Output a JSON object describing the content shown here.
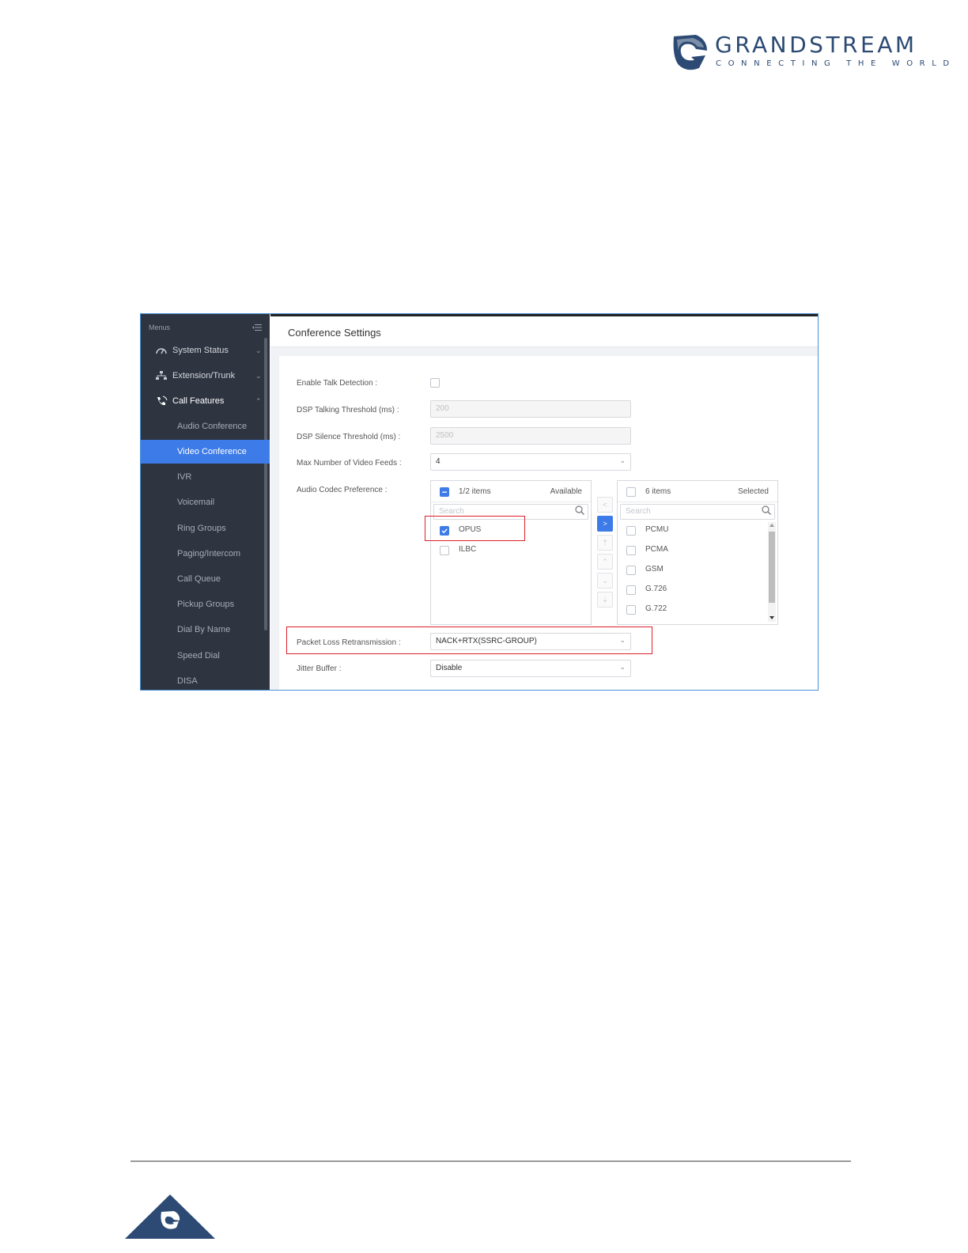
{
  "header": {
    "brand": "GRANDSTREAM",
    "tagline": "CONNECTING THE WORLD",
    "brand_color": "#2c4a73"
  },
  "sidebar": {
    "menus_label": "Menus",
    "items": [
      {
        "label": "System Status",
        "icon": "speedometer-icon",
        "chevron": "⌄"
      },
      {
        "label": "Extension/Trunk",
        "icon": "network-icon",
        "chevron": "⌄"
      },
      {
        "label": "Call Features",
        "icon": "phone-icon",
        "chevron": "⌃"
      }
    ],
    "sub_items": [
      "Audio Conference",
      "Video Conference",
      "IVR",
      "Voicemail",
      "Ring Groups",
      "Paging/Intercom",
      "Call Queue",
      "Pickup Groups",
      "Dial By Name",
      "Speed Dial",
      "DISA"
    ],
    "active_sub_item": "Video Conference",
    "active_color": "#3d7be8"
  },
  "content": {
    "title": "Conference Settings",
    "fields": {
      "enable_talk_detection": {
        "label": "Enable Talk Detection :"
      },
      "dsp_talking": {
        "label": "DSP Talking Threshold (ms) :",
        "value": "200"
      },
      "dsp_silence": {
        "label": "DSP Silence Threshold (ms) :",
        "value": "2500"
      },
      "max_video_feeds": {
        "label": "Max Number of Video Feeds :",
        "value": "4"
      },
      "audio_codec": {
        "label": "Audio Codec Preference :"
      },
      "packet_loss": {
        "label": "Packet Loss Retransmission :",
        "value": "NACK+RTX(SSRC-GROUP)"
      },
      "jitter_buffer": {
        "label": "Jitter Buffer :",
        "value": "Disable"
      }
    },
    "available": {
      "count": "1/2 items",
      "side": "Available",
      "search_placeholder": "Search",
      "items": [
        {
          "label": "OPUS",
          "checked": true
        },
        {
          "label": "ILBC",
          "checked": false
        }
      ]
    },
    "selected": {
      "count": "6 items",
      "side": "Selected",
      "search_placeholder": "Search",
      "items": [
        "PCMU",
        "PCMA",
        "GSM",
        "G.726",
        "G.722"
      ]
    },
    "transfer_buttons": [
      "<",
      ">",
      "⇡",
      "⌃",
      "⌄",
      "⇣"
    ]
  }
}
